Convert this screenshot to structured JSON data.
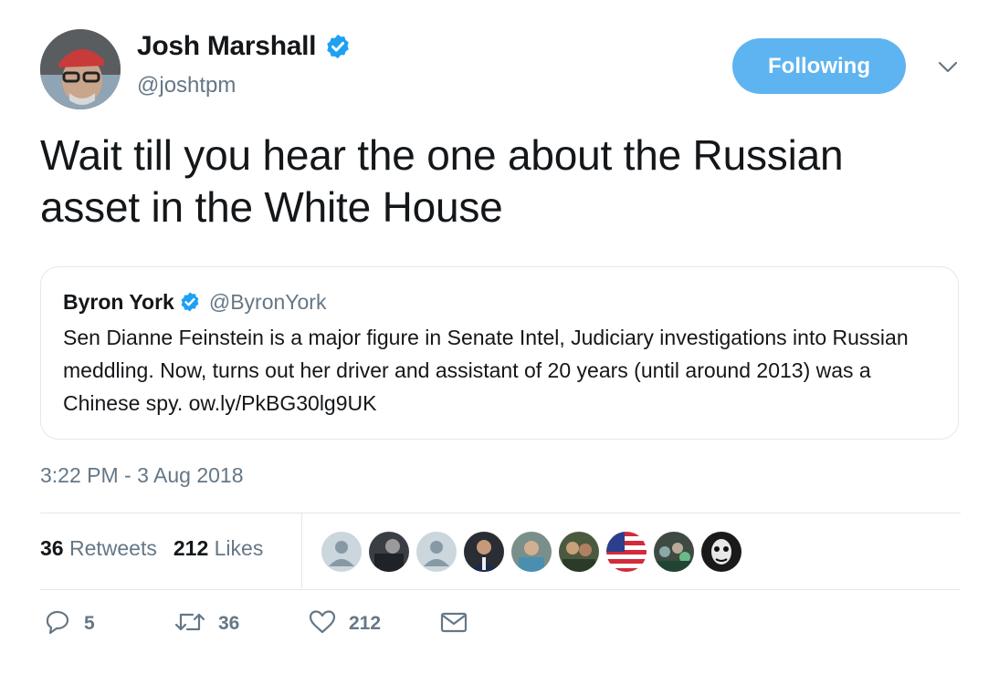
{
  "author": {
    "name": "Josh Marshall",
    "handle": "@joshtpm",
    "avatar_icon": "profile-photo-man-red-cap-glasses"
  },
  "follow_button": {
    "label": "Following",
    "color": "#5eb4f0"
  },
  "more_icon": "chevron-down-icon",
  "tweet": {
    "text": "Wait till you hear the one about the Russian asset in the White House",
    "timestamp": "3:22 PM - 3 Aug 2018"
  },
  "quoted_tweet": {
    "name": "Byron York",
    "handle": "@ByronYork",
    "text": "Sen Dianne Feinstein is a major figure in Senate Intel, Judiciary investigations into Russian meddling. Now, turns out her driver and assistant of 20 years (until around 2013) was a Chinese spy. ow.ly/PkBG30lg9UK"
  },
  "stats": {
    "retweets_count": "36",
    "retweets_label": "Retweets",
    "likes_count": "212",
    "likes_label": "Likes"
  },
  "likers": [
    "default-avatar-icon",
    "photo-avatar-icon",
    "default-avatar-icon",
    "photo-avatar-icon",
    "photo-avatar-icon",
    "photo-avatar-icon",
    "flag-avatar-icon",
    "photo-avatar-icon",
    "photo-avatar-icon"
  ],
  "actions": {
    "reply_count": "5",
    "retweet_count": "36",
    "like_count": "212"
  },
  "colors": {
    "verified": "#1da1f2",
    "secondary_text": "#657786",
    "border": "#e1e8ed"
  }
}
